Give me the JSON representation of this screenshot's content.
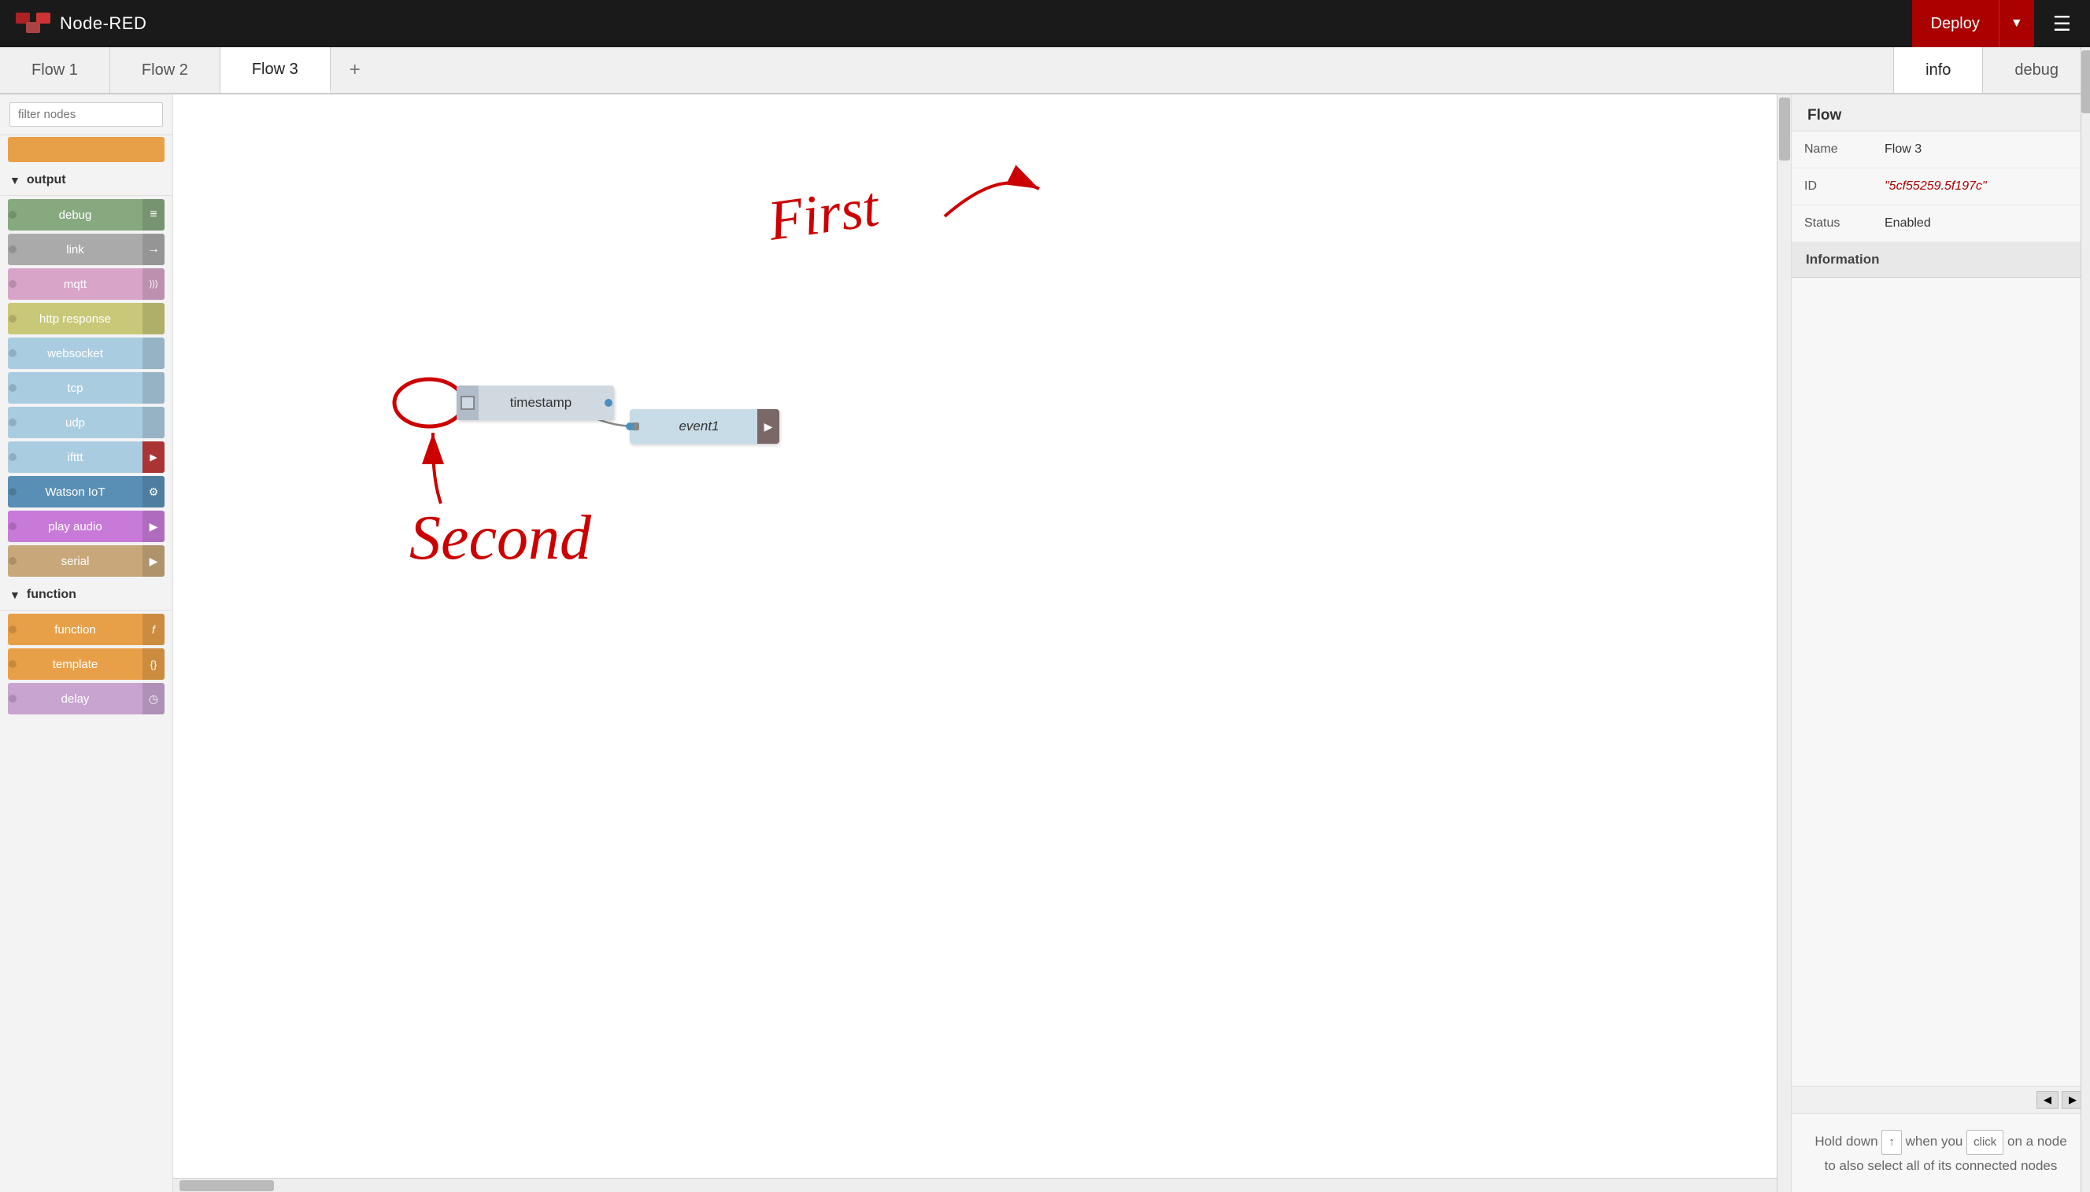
{
  "app": {
    "title": "Node-RED",
    "deploy_label": "Deploy",
    "hamburger": "☰"
  },
  "tabs": [
    {
      "label": "Flow 1",
      "active": false
    },
    {
      "label": "Flow 2",
      "active": false
    },
    {
      "label": "Flow 3",
      "active": true
    }
  ],
  "right_tabs": [
    {
      "label": "info",
      "active": true
    },
    {
      "label": "debug",
      "active": false
    }
  ],
  "sidebar": {
    "search_placeholder": "filter nodes",
    "sections": [
      {
        "label": "output",
        "nodes": [
          {
            "label": "debug",
            "color": "node-debug",
            "icon": "≡"
          },
          {
            "label": "link",
            "color": "node-link",
            "icon": "→"
          },
          {
            "label": "mqtt",
            "color": "node-mqtt",
            "icon": ")))"
          },
          {
            "label": "http response",
            "color": "node-http-response",
            "icon": ""
          },
          {
            "label": "websocket",
            "color": "node-websocket",
            "icon": ""
          },
          {
            "label": "tcp",
            "color": "node-tcp",
            "icon": ""
          },
          {
            "label": "udp",
            "color": "node-udp",
            "icon": ""
          },
          {
            "label": "ifttt",
            "color": "node-ifttt",
            "icon": "▶"
          },
          {
            "label": "Watson IoT",
            "color": "node-watson",
            "icon": "⚙"
          },
          {
            "label": "play audio",
            "color": "node-play-audio",
            "icon": "▶"
          },
          {
            "label": "serial",
            "color": "node-serial",
            "icon": "▶"
          }
        ]
      },
      {
        "label": "function",
        "nodes": [
          {
            "label": "function",
            "color": "node-function",
            "icon": "f"
          },
          {
            "label": "template",
            "color": "node-template",
            "icon": "{}"
          },
          {
            "label": "delay",
            "color": "node-delay",
            "icon": "◷"
          }
        ]
      }
    ]
  },
  "canvas_nodes": [
    {
      "id": "timestamp",
      "label": "timestamp",
      "type": "inject"
    },
    {
      "id": "event1",
      "label": "event1",
      "type": "output"
    }
  ],
  "info_panel": {
    "section_title": "Flow",
    "rows": [
      {
        "label": "Name",
        "value": "Flow 3",
        "style": "normal"
      },
      {
        "label": "ID",
        "value": "\"5cf55259.5f197c\"",
        "style": "red"
      },
      {
        "label": "Status",
        "value": "Enabled",
        "style": "normal"
      }
    ],
    "subsection": "Information",
    "hint_prefix": "Hold down",
    "hint_key": "↑",
    "hint_middle": "when you",
    "hint_action": "click",
    "hint_suffix": "on a node to also select all of its connected nodes"
  },
  "annotations": {
    "first_label": "First",
    "second_label": "Second"
  }
}
